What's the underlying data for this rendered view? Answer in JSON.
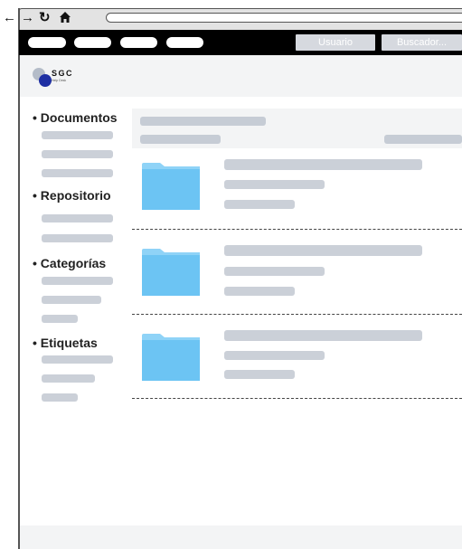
{
  "topbar": {
    "user_button": "Usuario",
    "search_button": "Buscador..."
  },
  "logo": {
    "text": "SGC",
    "subtitle": "Help Desk"
  },
  "sidebar": {
    "sections": [
      {
        "title": "• Documentos"
      },
      {
        "title": "• Repositorio"
      },
      {
        "title": "• Categorías"
      },
      {
        "title": "• Etiquetas"
      }
    ]
  },
  "icons": {
    "back": "back-arrow-icon",
    "forward": "forward-arrow-icon",
    "reload": "reload-icon",
    "home": "home-icon",
    "folder": "folder-icon"
  },
  "colors": {
    "folder": "#6cc4f3",
    "topbar": "#000000",
    "skeleton": "#cbd0d8",
    "panel": "#f3f4f5"
  }
}
